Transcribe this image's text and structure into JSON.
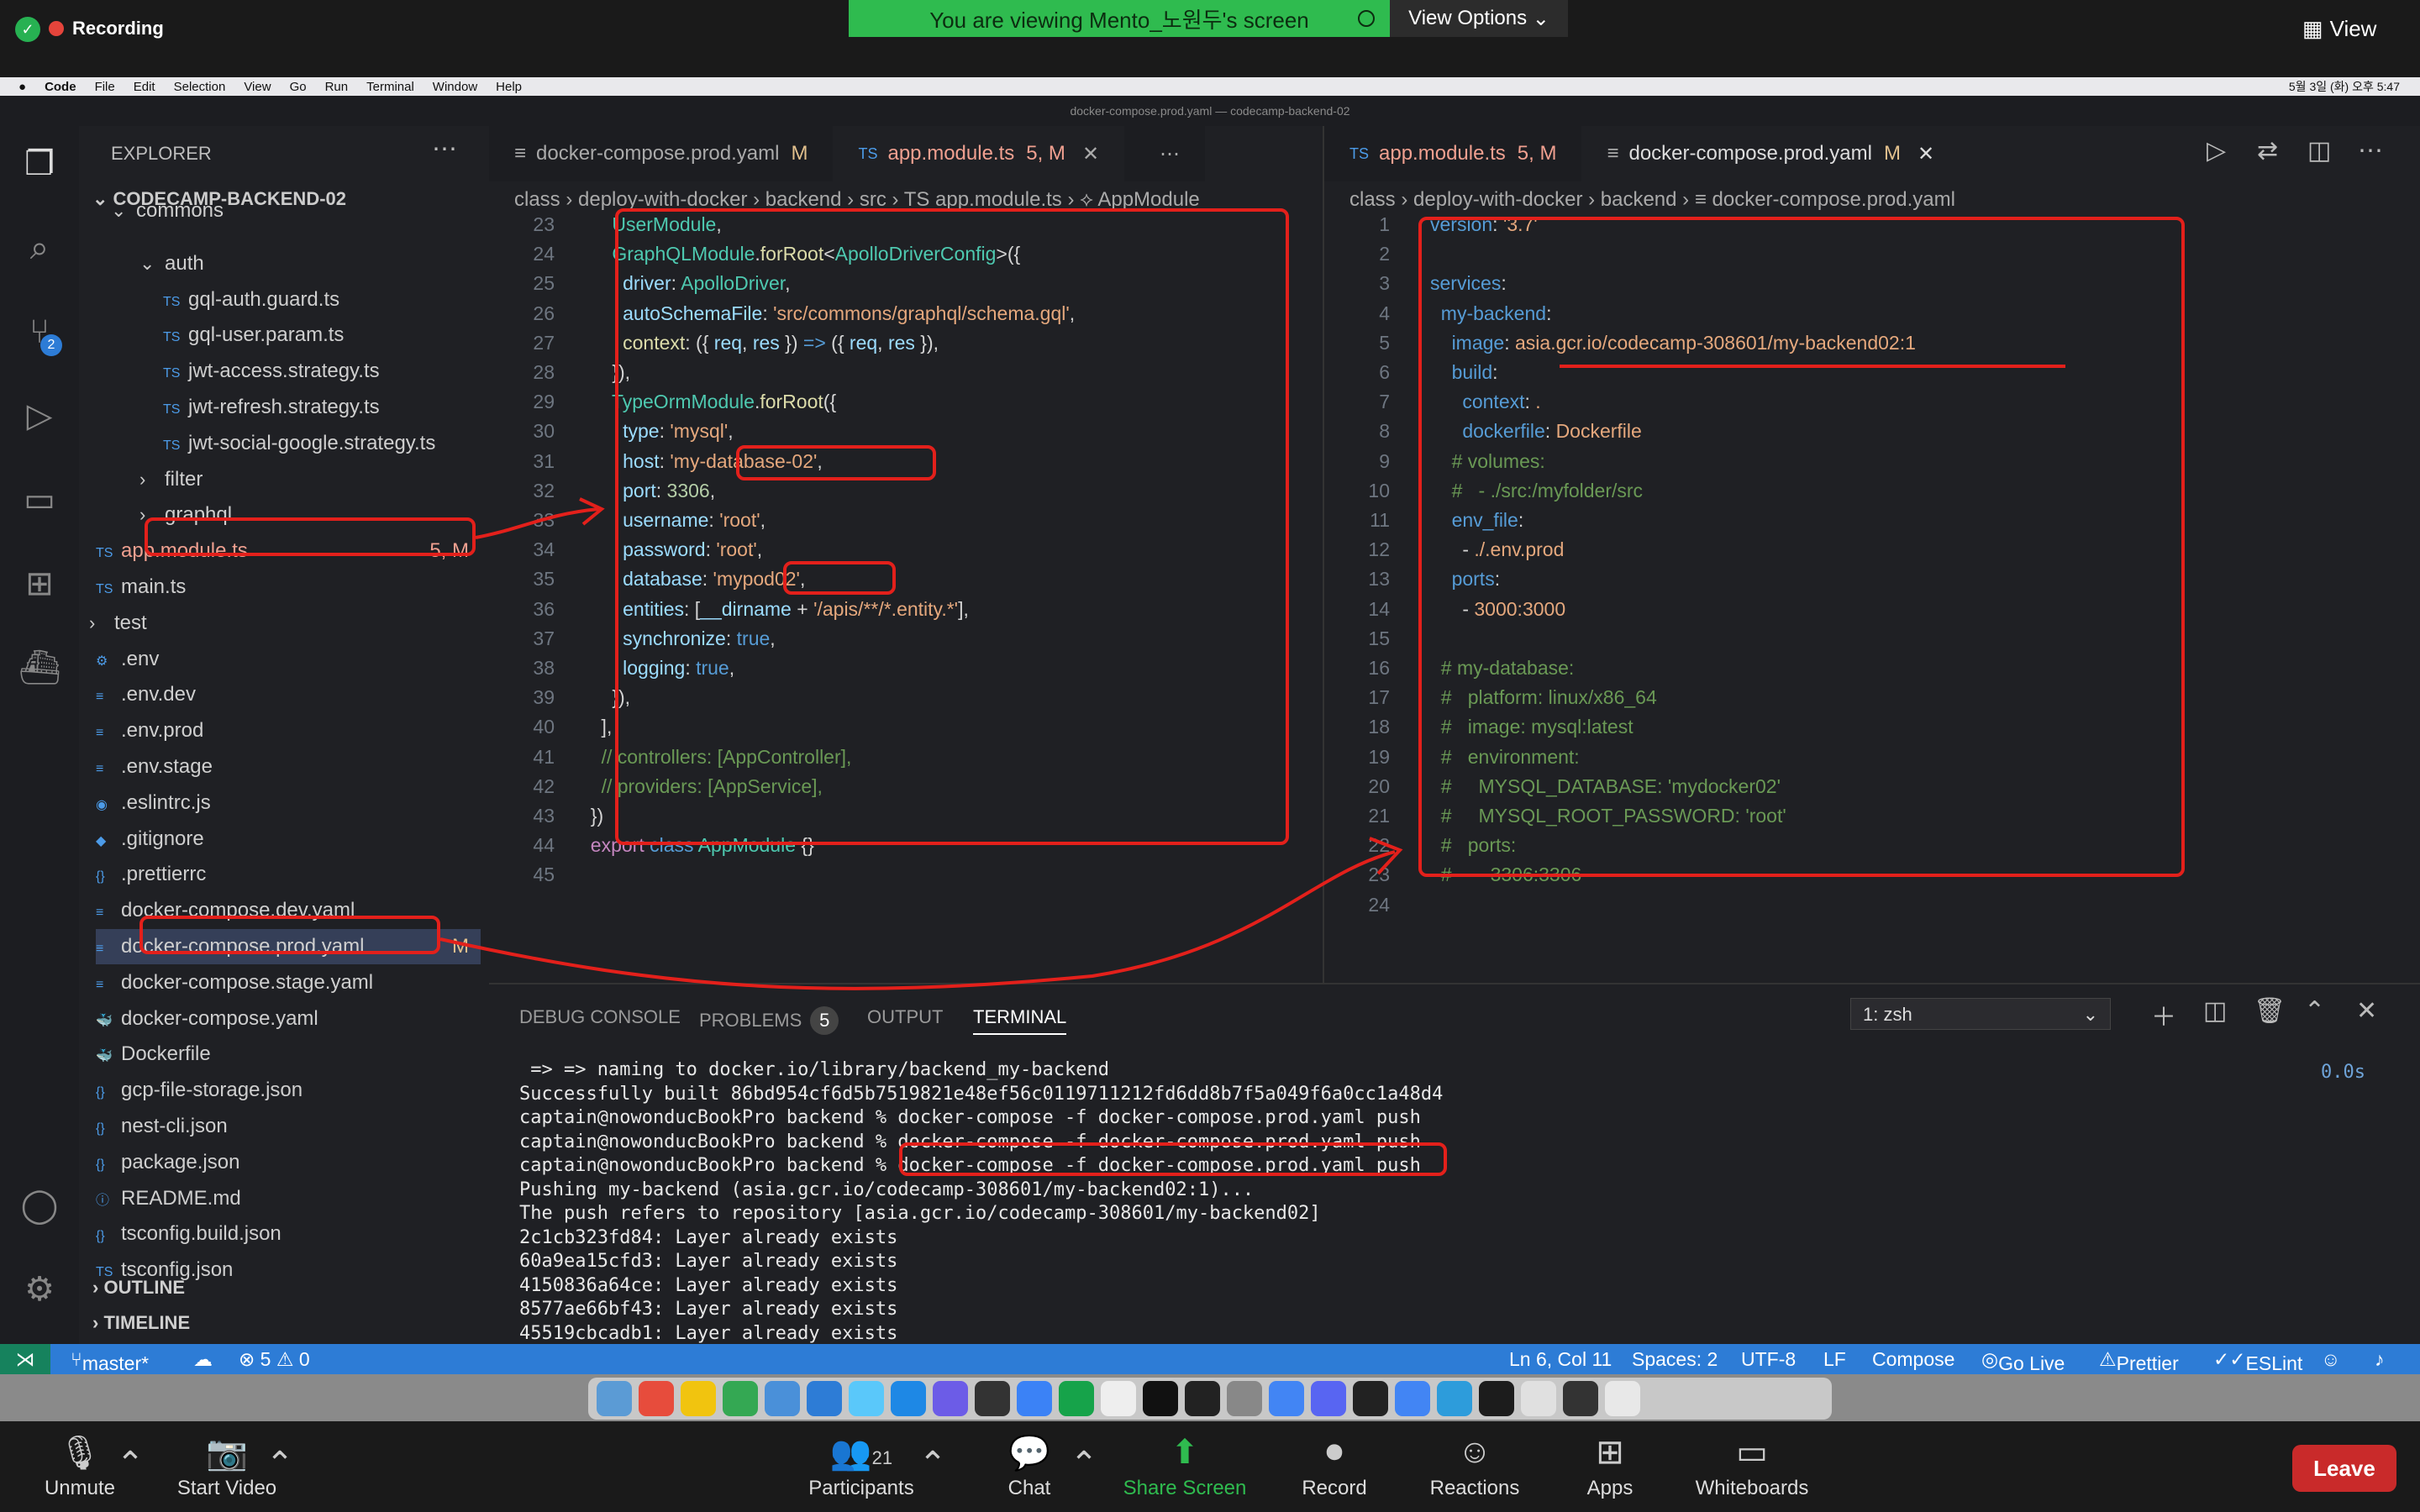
{
  "zoom": {
    "recording": "Recording",
    "banner": "You are viewing Mento_노원두's screen",
    "view_options": "View Options",
    "view": "View",
    "bottom": {
      "unmute": "Unmute",
      "start_video": "Start Video",
      "participants": "Participants",
      "participants_count": "21",
      "chat": "Chat",
      "share": "Share Screen",
      "record": "Record",
      "reactions": "Reactions",
      "apps": "Apps",
      "whiteboards": "Whiteboards",
      "leave": "Leave"
    }
  },
  "mac": {
    "menu": [
      "Code",
      "File",
      "Edit",
      "Selection",
      "View",
      "Go",
      "Run",
      "Terminal",
      "Window",
      "Help"
    ],
    "clock": "5월 3일 (화) 오후 5:47"
  },
  "window_title": "docker-compose.prod.yaml — codecamp-backend-02",
  "explorer": {
    "title": "EXPLORER",
    "project": "CODECAMP-BACKEND-02",
    "items": [
      {
        "label": "commons"
      },
      {
        "label": "auth"
      },
      {
        "label": "gql-auth.guard.ts",
        "icon": "TS"
      },
      {
        "label": "gql-user.param.ts",
        "icon": "TS"
      },
      {
        "label": "jwt-access.strategy.ts",
        "icon": "TS"
      },
      {
        "label": "jwt-refresh.strategy.ts",
        "icon": "TS"
      },
      {
        "label": "jwt-social-google.strategy.ts",
        "icon": "TS"
      },
      {
        "label": "filter"
      },
      {
        "label": "graphql"
      },
      {
        "label": "app.module.ts",
        "icon": "TS",
        "badge": "5, M"
      },
      {
        "label": "main.ts",
        "icon": "TS"
      },
      {
        "label": "test"
      },
      {
        "label": ".env",
        "icon": "⚙"
      },
      {
        "label": ".env.dev",
        "icon": "≡"
      },
      {
        "label": ".env.prod",
        "icon": "≡"
      },
      {
        "label": ".env.stage",
        "icon": "≡"
      },
      {
        "label": ".eslintrc.js",
        "icon": "◉"
      },
      {
        "label": ".gitignore",
        "icon": "◆"
      },
      {
        "label": ".prettierrc",
        "icon": "{}"
      },
      {
        "label": "docker-compose.dev.yaml",
        "icon": "≡"
      },
      {
        "label": "docker-compose.prod.yaml",
        "icon": "≡",
        "badge": "M"
      },
      {
        "label": "docker-compose.stage.yaml",
        "icon": "≡"
      },
      {
        "label": "docker-compose.yaml",
        "icon": "🐳"
      },
      {
        "label": "Dockerfile",
        "icon": "🐳"
      },
      {
        "label": "gcp-file-storage.json",
        "icon": "{}"
      },
      {
        "label": "nest-cli.json",
        "icon": "{}"
      },
      {
        "label": "package.json",
        "icon": "{}"
      },
      {
        "label": "README.md",
        "icon": "ⓘ"
      },
      {
        "label": "tsconfig.build.json",
        "icon": "{}"
      },
      {
        "label": "tsconfig.json",
        "icon": "TS"
      }
    ],
    "outline": "OUTLINE",
    "timeline": "TIMELINE"
  },
  "editor_left": {
    "tabs": [
      {
        "label": "docker-compose.prod.yaml",
        "mark": "M"
      },
      {
        "label": "app.module.ts",
        "mark": "5, M"
      }
    ],
    "breadcrumb": "class  ›  deploy-with-docker  ›  backend  ›  src  ›  TS app.module.ts  ›  ⟡ AppModule",
    "line_numbers": "23\n24\n25\n26\n27\n28\n29\n30\n31\n32\n33\n34\n35\n36\n37\n38\n39\n40\n41\n42\n43\n44\n45"
  },
  "editor_right": {
    "tabs": [
      {
        "label": "app.module.ts",
        "mark": "5, M"
      },
      {
        "label": "docker-compose.prod.yaml",
        "mark": "M"
      }
    ],
    "breadcrumb": "class  ›  deploy-with-docker  ›  backend  ›  ≡ docker-compose.prod.yaml",
    "line_numbers": "1\n2\n3\n4\n5\n6\n7\n8\n9\n10\n11\n12\n13\n14\n15\n16\n17\n18\n19\n20\n21\n22\n23\n24"
  },
  "panel": {
    "tabs": [
      "DEBUG CONSOLE",
      "PROBLEMS",
      "OUTPUT",
      "TERMINAL"
    ],
    "problems_count": "5",
    "shell": "1: zsh",
    "time": "0.0s",
    "terminal": " => => naming to docker.io/library/backend_my-backend\nSuccessfully built 86bd954cf6d5b7519821e48ef56c0119711212fd6dd8b7f5a049f6a0cc1a48d4\ncaptain@nowonducBookPro backend % docker-compose -f docker-compose.prod.yaml push\ncaptain@nowonducBookPro backend % docker-compose -f docker-compose.prod.yaml push\ncaptain@nowonducBookPro backend % docker-compose -f docker-compose.prod.yaml push\nPushing my-backend (asia.gcr.io/codecamp-308601/my-backend02:1)...\nThe push refers to repository [asia.gcr.io/codecamp-308601/my-backend02]\n2c1cb323fd84: Layer already exists\n60a9ea15cfd3: Layer already exists\n4150836a64ce: Layer already exists\n8577ae66bf43: Layer already exists\n45519cbcadb1: Layer already exists"
  },
  "status": {
    "branch": "master*",
    "errors": "⊗ 5 ⚠ 0",
    "position": "Ln 6, Col 11",
    "spaces": "Spaces: 2",
    "encoding": "UTF-8",
    "eol": "LF",
    "language": "Compose",
    "golive": "Go Live",
    "prettier": "Prettier",
    "eslint": "ESLint"
  }
}
